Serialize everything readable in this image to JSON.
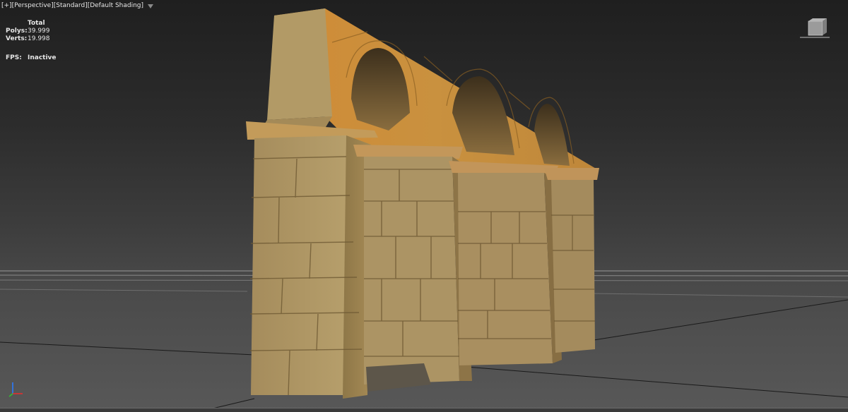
{
  "viewport": {
    "labels": [
      "[+]",
      "[Perspective]",
      "[Standard]",
      "[Default Shading]"
    ],
    "stats": {
      "header": "Total",
      "rows": [
        {
          "label": "Polys:",
          "value": "39.999"
        },
        {
          "label": "Verts:",
          "value": "19.998"
        }
      ],
      "fps_label": "FPS:",
      "fps_value": "Inactive"
    },
    "viewcube_icon": "viewcube-icon",
    "axis_icon": "axis-tripod-icon",
    "filter_icon": "filter-icon"
  },
  "colors": {
    "background_top": "#1f1f1f",
    "background_bottom": "#585858",
    "grid_line": "#777777",
    "stone_light": "#b9a06c",
    "stone_dark": "#7d6840",
    "arch_orange": "#c8893a"
  }
}
